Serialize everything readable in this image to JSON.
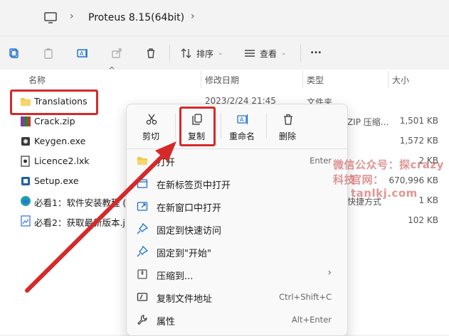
{
  "address": {
    "path": "Proteus 8.15(64bit)"
  },
  "toolbar": {
    "sort_label": "排序",
    "view_label": "查看",
    "more_label": "..."
  },
  "columns": {
    "name": "名称",
    "date": "修改日期",
    "type": "类型",
    "size": "大小"
  },
  "files": [
    {
      "name": "Translations",
      "date": "2023/2/24 21:45",
      "type": "文件夹",
      "size": ""
    },
    {
      "name": "Crack.zip",
      "date": "",
      "type": "ZIP 压缩...",
      "size": "1,501 KB"
    },
    {
      "name": "Keygen.exe",
      "date": "",
      "type": "",
      "size": "1,572 KB"
    },
    {
      "name": "Licence2.lxk",
      "date": "",
      "type": "",
      "size": "2 KB"
    },
    {
      "name": "Setup.exe",
      "date": "",
      "type": "",
      "size": "670,996 KB"
    },
    {
      "name": "必看1：软件安装教程 (",
      "date": "",
      "type": "快捷方式",
      "size": "1 KB"
    },
    {
      "name": "必看2：获取最新版本.jp",
      "date": "",
      "type": "",
      "size": "102 KB"
    }
  ],
  "context_menu": {
    "quick_actions": [
      {
        "label": "剪切",
        "icon": "scissors-icon"
      },
      {
        "label": "复制",
        "icon": "copy-icon"
      },
      {
        "label": "重命名",
        "icon": "rename-icon"
      },
      {
        "label": "删除",
        "icon": "trash-icon"
      }
    ],
    "items": [
      {
        "label": "打开",
        "shortcut": "Enter",
        "icon": "folder-icon"
      },
      {
        "label": "在新标签页中打开",
        "shortcut": "",
        "icon": "new-tab-icon"
      },
      {
        "label": "在新窗口中打开",
        "shortcut": "",
        "icon": "new-window-icon"
      },
      {
        "label": "固定到快速访问",
        "shortcut": "",
        "icon": "pin-icon"
      },
      {
        "label": "固定到\"开始\"",
        "shortcut": "",
        "icon": "pin-icon"
      },
      {
        "label": "压缩到...",
        "shortcut": "",
        "icon": "archive-icon"
      },
      {
        "label": "复制文件地址",
        "shortcut": "Ctrl+Shift+C",
        "icon": "path-icon"
      },
      {
        "label": "属性",
        "shortcut": "Alt+Enter",
        "icon": "wrench-icon"
      }
    ]
  },
  "watermark": {
    "line1": "微信公众号：探crazy科技",
    "line2": "官网：tanlkj.com"
  },
  "colors": {
    "highlight_red": "#d42a2a",
    "arrow_red": "#d42a2a",
    "folder_yellow": "#f4c542"
  }
}
